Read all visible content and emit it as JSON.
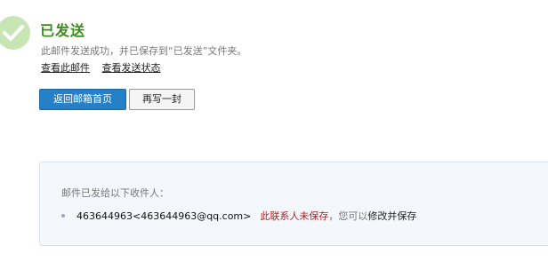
{
  "header": {
    "title": "已发送",
    "subtitle": "此邮件发送成功，并已保存到“已发送”文件夹。",
    "links": [
      "查看此邮件",
      "查看发送状态"
    ]
  },
  "buttons": {
    "back_home": "返回邮箱首页",
    "write_another": "再写一封"
  },
  "recipients": {
    "label": "邮件已发给以下收件人：",
    "items": [
      {
        "address": "463644963<463644963@qq.com>",
        "status": "此联系人未保存",
        "hint": "，您可以",
        "action": "修改并保存"
      }
    ]
  },
  "colors": {
    "success_green": "#3d8b1c",
    "icon_bg": "#c8e6b4",
    "primary_blue": "#2580c8",
    "warning_red": "#b02020",
    "panel_bg": "#f4f8fd"
  },
  "icons": {
    "status": "checkmark-icon"
  }
}
